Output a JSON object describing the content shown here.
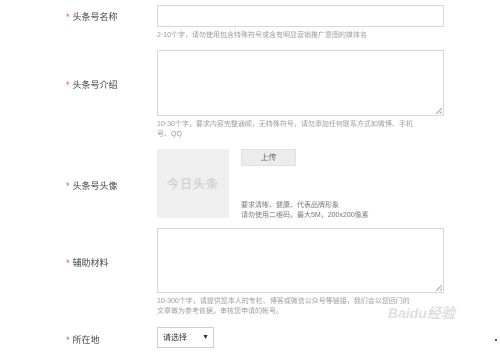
{
  "form": {
    "name": {
      "label": "头条号名称",
      "hint": "2-10个字，请勿使用包含特殊符号或含有明显营销推广意图的媒体名"
    },
    "intro": {
      "label": "头条号介绍",
      "hint1": "10-30个字，要求内容完整通顺，无特殊符号，请勿添加任何联系方式如微博、手机",
      "hint2": "号、QQ"
    },
    "avatar": {
      "label": "头条号头像",
      "placeholder": "今日头条",
      "upload_label": "上传",
      "req1": "要求清晰、健康、代表品牌形象",
      "req2": "请勿使用二维码，最大5M，200x200像素"
    },
    "aux": {
      "label": "辅助材料",
      "hint1": "10-300个字，请提供您本人的专栏、博客或微信公众号等链接，我们会以您回门的",
      "hint2": "文章做为参考依据，审核您申请的帐号。"
    },
    "location": {
      "label": "所在地",
      "select_value": "请选择"
    }
  },
  "watermark": "Baidu经验",
  "required_mark": "*"
}
